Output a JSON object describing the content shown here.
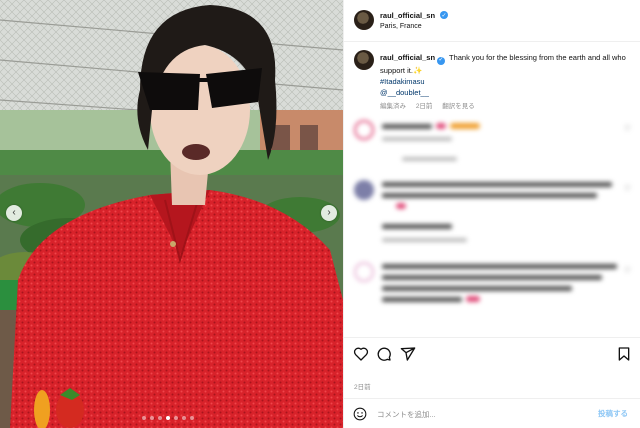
{
  "post": {
    "username": "raul_official_sn",
    "location": "Paris, France",
    "caption": {
      "username": "raul_official_sn",
      "text": "Thank you for the blessing from the earth and all who support it.",
      "emoji": "✨",
      "hashtag": "#Itadakimasu",
      "mention": "@__doublet__",
      "meta_edited": "編集済み",
      "meta_time": "2日前",
      "meta_translate": "翻訳を見る"
    },
    "date": "2日前",
    "carousel": {
      "count": 7,
      "active_index": 3
    }
  },
  "comment_box": {
    "placeholder": "コメントを追加...",
    "post_label": "投稿する"
  },
  "icons": {
    "prev": "chevron-left-icon",
    "next": "chevron-right-icon",
    "like": "heart-icon",
    "comment": "comment-icon",
    "share": "share-icon",
    "save": "bookmark-icon",
    "emoji": "emoji-icon"
  },
  "colors": {
    "verified": "#3897f0",
    "link": "#00376b",
    "post_button": "#8ec7f5",
    "muted": "#8e8e8e",
    "jacket": "#d61f26"
  }
}
